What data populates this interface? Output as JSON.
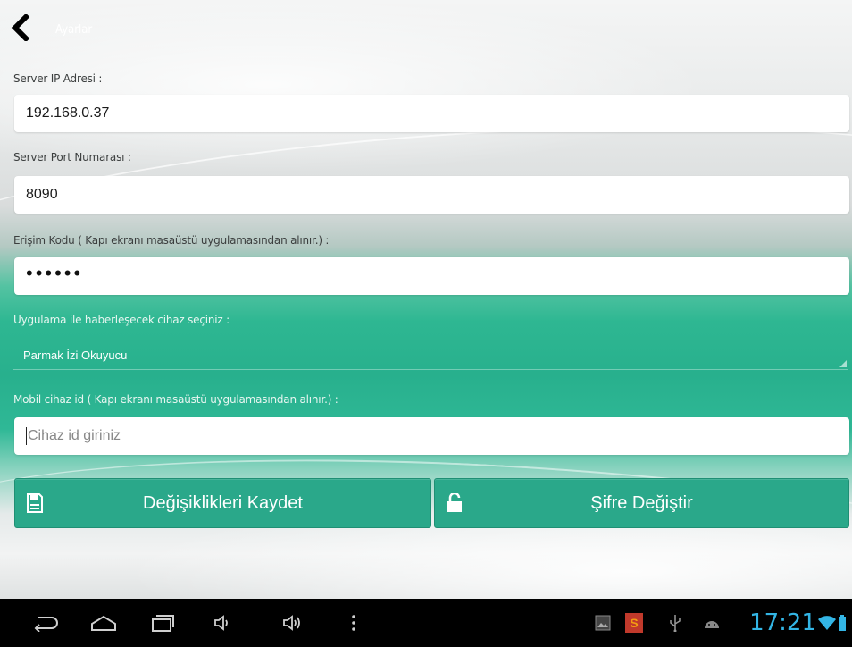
{
  "header": {
    "title": "Ayarlar"
  },
  "form": {
    "server_ip": {
      "label": "Server IP Adresi :",
      "value": "192.168.0.37"
    },
    "server_port": {
      "label": "Server Port Numarası :",
      "value": "8090"
    },
    "access_code": {
      "label": "Erişim Kodu ( Kapı ekranı masaüstü uygulamasından alınır.) :",
      "value": "••••••"
    },
    "device_select": {
      "label": "Uygulama ile haberleşecek cihaz seçiniz :",
      "selected": "Parmak İzi Okuyucu"
    },
    "mobile_device_id": {
      "label": "Mobil cihaz id ( Kapı ekranı masaüstü uygulamasından alınır.) :",
      "placeholder": "Cihaz id giriniz"
    }
  },
  "buttons": {
    "save_label": "Değişiklikleri Kaydet",
    "save_icon": "floppy-disk-icon",
    "change_password_label": "Şifre Değiştir",
    "change_password_icon": "lock-icon"
  },
  "system_bar": {
    "time": "17:21",
    "accent_color": "#33b5e5"
  },
  "colors": {
    "button_bg": "#2aa88a",
    "teal_band": "#2eb792"
  }
}
